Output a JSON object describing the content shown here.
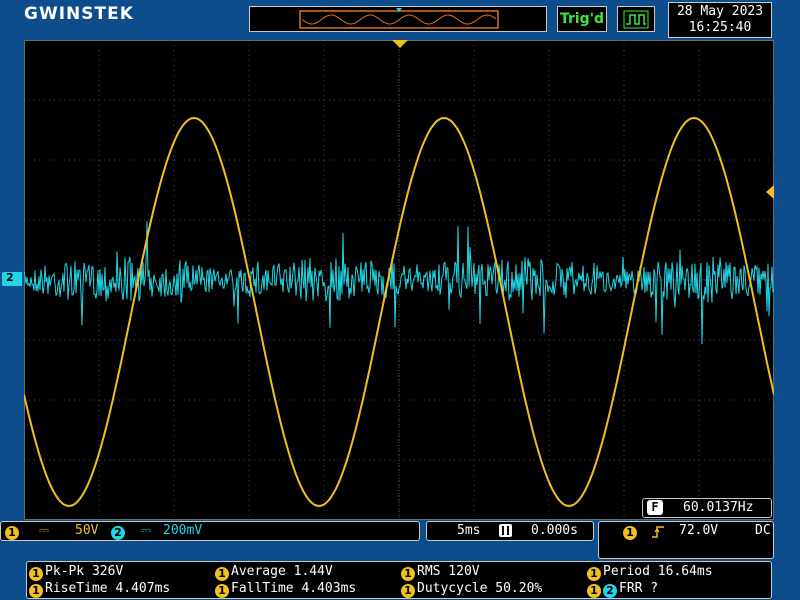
{
  "header": {
    "logo": "GWINSTEK",
    "trigger_status": "Trig'd",
    "acquire_icon": "pulse-waveform-icon",
    "date": "28 May 2023",
    "time": "16:25:40"
  },
  "colors": {
    "ch1": "#f0c020",
    "ch2": "#20d6e6",
    "background": "#0e4d8c",
    "grid": "#4a4a4a",
    "trigger_ok": "#3ee83e"
  },
  "screen": {
    "ch2_marker": "2",
    "frequency": "60.0137Hz",
    "frequency_icon": "F"
  },
  "channels": {
    "ch1": {
      "id": "1",
      "coupling_icon": "dc-coupling-icon",
      "scale": "50V"
    },
    "ch2": {
      "id": "2",
      "coupling_icon": "dc-coupling-icon",
      "scale": "200mV"
    }
  },
  "timebase": {
    "scale": "5ms",
    "position": "0.000s",
    "position_icon": "horizontal-position-icon"
  },
  "trigger": {
    "source": "1",
    "slope_icon": "rising-edge-icon",
    "level": "72.0V",
    "coupling": "DC"
  },
  "measurements": [
    {
      "ch": "1",
      "label": "Pk-Pk 326V"
    },
    {
      "ch": "1",
      "label": "Average 1.44V"
    },
    {
      "ch": "1",
      "label": "RMS 120V"
    },
    {
      "ch": "1",
      "label": "Period 16.64ms"
    },
    {
      "ch": "1",
      "label": "RiseTime 4.407ms"
    },
    {
      "ch": "1",
      "label": "FallTime 4.403ms"
    },
    {
      "ch": "1",
      "label": "Dutycycle 50.20%"
    },
    {
      "ch": "1",
      "ch_b": "2",
      "label": "FRR ?"
    }
  ]
}
